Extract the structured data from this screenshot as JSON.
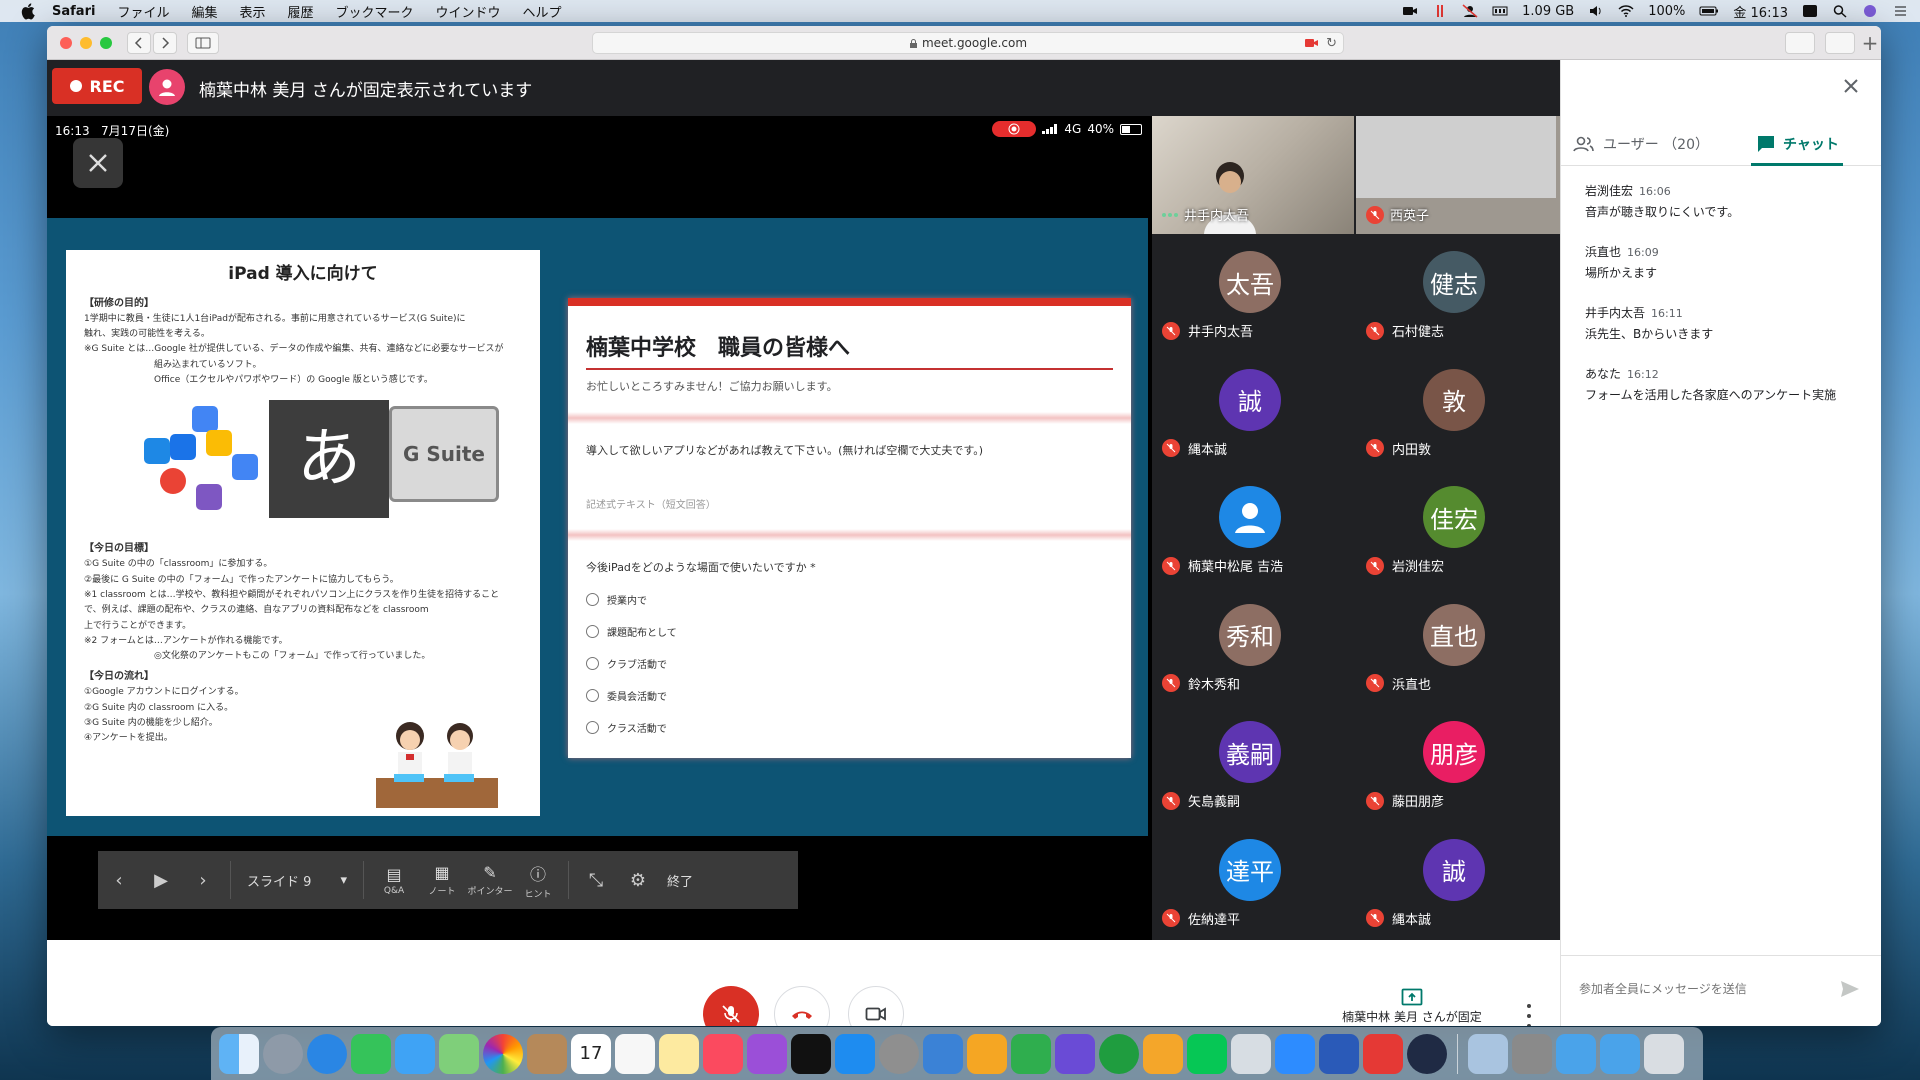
{
  "menubar": {
    "app": "Safari",
    "items": [
      "ファイル",
      "編集",
      "表示",
      "履歴",
      "ブックマーク",
      "ウインドウ",
      "ヘルプ"
    ],
    "memory": "1.09 GB",
    "battery": "100%",
    "clock": "金 16:13"
  },
  "browser": {
    "url": "meet.google.com"
  },
  "meet": {
    "rec_label": "REC",
    "pinned_banner": "楠葉中林 美月 さんが固定表示されています",
    "ipad_time": "16:13",
    "ipad_date": "7月17日(金)",
    "ipad_signal": "4G",
    "ipad_battery": "40%",
    "doc": {
      "title": "iPad 導入に向けて",
      "heading1": "【研修の目的】",
      "line1": "1学期中に教員・生徒に1人1台iPadが配布される。事前に用意されているサービス(G Suite)に",
      "line2": "触れ、実践の可能性を考える。",
      "line3": "※G Suite とは…Google 社が提供している、データの作成や編集、共有、連絡などに必要なサービスが",
      "line4": "組み込まれているソフト。",
      "line5": "Office（エクセルやパワポやワード）の Google 版という感じです。",
      "ime_char": "あ",
      "gsuite": "G Suite",
      "heading2": "【今日の目標】",
      "line6": "①G Suite の中の「classroom」に参加する。",
      "line7": "②最後に G Suite の中の「フォーム」で作ったアンケートに協力してもらう。",
      "line8": "※1 classroom とは…学校や、教科担や顧問がそれぞれパソコン上にクラスを作り生徒を招待すること",
      "line9": "で、例えば、課題の配布や、クラスの連絡、自なアプリの資料配布などを classroom",
      "line10": "上で行うことができます。",
      "line11": "※2 フォームとは…アンケートが作れる機能です。",
      "line12": "◎文化祭のアンケートもこの「フォーム」で作って行っていました。",
      "heading3": "【今日の流れ】",
      "line13": "①Google アカウントにログインする。",
      "line14": "②G Suite 内の classroom に入る。",
      "line15": "③G Suite 内の機能を少し紹介。",
      "line16": "④アンケートを提出。"
    },
    "form": {
      "title": "楠葉中学校　職員の皆様へ",
      "description": "お忙しいところすみません！ご協力お願いします。",
      "q1": "導入して欲しいアプリなどがあれば教えて下さい。(無ければ空欄で大丈夫です。)",
      "q1_answer": "記述式テキスト（短文回答）",
      "q2": "今後iPadをどのような場面で使いたいですか *",
      "options": [
        "授業内で",
        "課題配布として",
        "クラブ活動で",
        "委員会活動で",
        "クラス活動で"
      ]
    },
    "toolbar": {
      "slide_label": "スライド 9",
      "qa": "Q&A",
      "note": "ノート",
      "pointer": "ポインター",
      "hint": "ヒント",
      "end": "終了"
    },
    "video_tiles": [
      {
        "name": "井手内太吾"
      },
      {
        "name": "西英子"
      }
    ],
    "participants": [
      {
        "initials": "太吾",
        "name": "井手内太吾",
        "color": "#8d6e63"
      },
      {
        "initials": "健志",
        "name": "石村健志",
        "color": "#455a64"
      },
      {
        "initials": "誠",
        "name": "縄本誠",
        "color": "#5e35b1"
      },
      {
        "initials": "敦",
        "name": "内田敦",
        "color": "#795548"
      },
      {
        "initials": "",
        "name": "楠葉中松尾 吉浩",
        "color": "#1e88e5"
      },
      {
        "initials": "佳宏",
        "name": "岩渕佳宏",
        "color": "#558b2f"
      },
      {
        "initials": "秀和",
        "name": "鈴木秀和",
        "color": "#8d6e63"
      },
      {
        "initials": "直也",
        "name": "浜直也",
        "color": "#8d6e63"
      },
      {
        "initials": "義嗣",
        "name": "矢島義嗣",
        "color": "#5e35b1"
      },
      {
        "initials": "朋彦",
        "name": "藤田朋彦",
        "color": "#e91e63"
      },
      {
        "initials": "達平",
        "name": "佐納達平",
        "color": "#1e88e5"
      },
      {
        "initials": "誠",
        "name": "縄本誠",
        "color": "#5e35b1"
      }
    ],
    "present_info": "楠葉中林 美月 さんが固定表示されています"
  },
  "sidepanel": {
    "users_tab": "ユーザー （20）",
    "chat_tab": "チャット",
    "messages": [
      {
        "sender": "岩渕佳宏",
        "time": "16:06",
        "text": "音声が聴き取りにくいです。"
      },
      {
        "sender": "浜直也",
        "time": "16:09",
        "text": "場所かえます"
      },
      {
        "sender": "井手内太吾",
        "time": "16:11",
        "text": "浜先生、Bからいきます"
      },
      {
        "sender": "あなた",
        "time": "16:12",
        "text": "フォームを活用した各家庭へのアンケート実施"
      }
    ],
    "input_placeholder": "参加者全員にメッセージを送信"
  },
  "dock": {
    "calendar_day": "17"
  },
  "colors": {
    "meet_dark": "#202124",
    "rec_red": "#d93025",
    "chat_accent": "#00796b",
    "slide_bg": "#0d5474"
  }
}
